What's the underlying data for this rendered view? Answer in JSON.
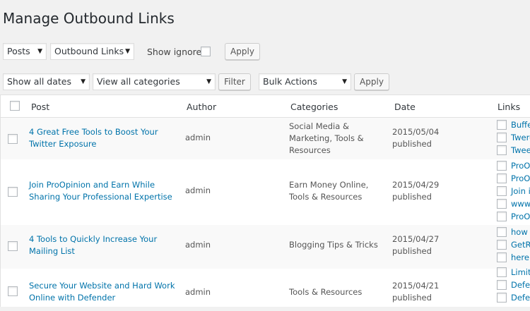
{
  "page": {
    "title": "Manage Outbound Links"
  },
  "filters1": {
    "post_type": "Posts",
    "link_type": "Outbound Links",
    "show_ignored_label": "Show ignored",
    "apply_label": "Apply"
  },
  "filters2": {
    "dates": "Show all dates",
    "categories": "View all categories",
    "filter_label": "Filter",
    "bulk_actions": "Bulk Actions",
    "apply_label": "Apply"
  },
  "table": {
    "headers": {
      "post": "Post",
      "author": "Author",
      "categories": "Categories",
      "date": "Date",
      "links": "Links"
    },
    "rows": [
      {
        "title": [
          "4 Great Free Tools to Boost Your",
          "Twitter Exposure"
        ],
        "author": "admin",
        "categories": [
          "Social Media &",
          "Marketing, Tools &",
          "Resources"
        ],
        "date": "2015/05/04",
        "status": "published",
        "links": [
          "Buffer",
          "Twero",
          "Tweet"
        ]
      },
      {
        "title": [
          "Join ProOpinion and Earn While",
          "Sharing Your Professional Expertise"
        ],
        "author": "admin",
        "categories": [
          "Earn Money Online,",
          "Tools & Resources"
        ],
        "date": "2015/04/29",
        "status": "published",
        "links": [
          "ProOp",
          "ProOp",
          "Join it",
          "www.",
          "ProOp"
        ]
      },
      {
        "title": [
          "4 Tools to Quickly Increase Your",
          "Mailing List"
        ],
        "author": "admin",
        "categories": [
          "Blogging Tips & Tricks"
        ],
        "date": "2015/04/27",
        "status": "published",
        "links": [
          "how t",
          "GetRe",
          "here"
        ]
      },
      {
        "title": [
          "Secure Your Website and Hard Work",
          "Online with Defender"
        ],
        "author": "admin",
        "categories": [
          "Tools & Resources"
        ],
        "date": "2015/04/21",
        "status": "published",
        "links": [
          "Limit",
          "Defen",
          "Defe"
        ]
      }
    ]
  }
}
